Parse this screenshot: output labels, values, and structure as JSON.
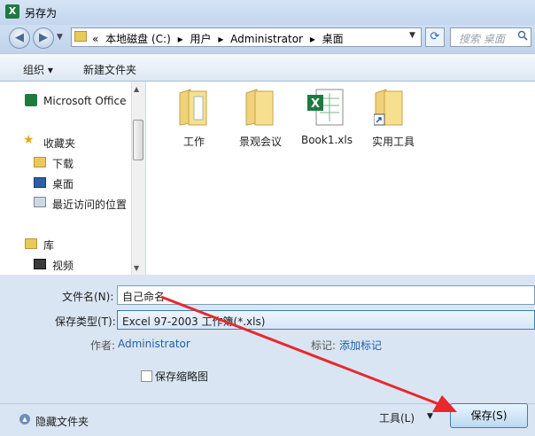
{
  "window": {
    "title": "另存为",
    "app_icon": "excel-icon"
  },
  "address": {
    "back_icon": "back-arrow-icon",
    "forward_icon": "forward-arrow-icon",
    "breadcrumbs": [
      "«",
      "本地磁盘 (C:)",
      "▸",
      "用户",
      "▸",
      "Administrator",
      "▸",
      "桌面"
    ],
    "search_placeholder": "搜索 桌面"
  },
  "toolbar": {
    "organize": "组织 ▾",
    "new_folder": "新建文件夹"
  },
  "nav": {
    "items": [
      {
        "label": "Microsoft Office",
        "icon": "excel-icon"
      },
      {
        "label": "收藏夹",
        "icon": "star-icon"
      },
      {
        "label": "下载",
        "icon": "download-folder-icon"
      },
      {
        "label": "桌面",
        "icon": "desktop-icon"
      },
      {
        "label": "最近访问的位置",
        "icon": "recent-places-icon"
      },
      {
        "label": "库",
        "icon": "library-icon"
      },
      {
        "label": "视频",
        "icon": "video-icon"
      }
    ]
  },
  "files": [
    {
      "name": "工作",
      "icon": "folder-icon"
    },
    {
      "name": "景观会议",
      "icon": "folder-icon"
    },
    {
      "name": "Book1.xls",
      "icon": "excel-file-icon"
    },
    {
      "name": "实用工具",
      "icon": "shortcut-folder-icon"
    }
  ],
  "form": {
    "filename_label": "文件名(N):",
    "filename_value": "自己命名",
    "filetype_label": "保存类型(T):",
    "filetype_value": "Excel 97-2003 工作簿(*.xls)",
    "author_label": "作者:",
    "author_value": "Administrator",
    "tags_label": "标记:",
    "tags_value": "添加标记",
    "thumbnail_label": "保存缩略图"
  },
  "footer": {
    "hide_folders": "隐藏文件夹",
    "tools": "工具(L)",
    "save": "保存(S)"
  },
  "colors": {
    "arrow": "#e8282b",
    "link": "#1f5fa8",
    "panel": "#dae5f3"
  }
}
